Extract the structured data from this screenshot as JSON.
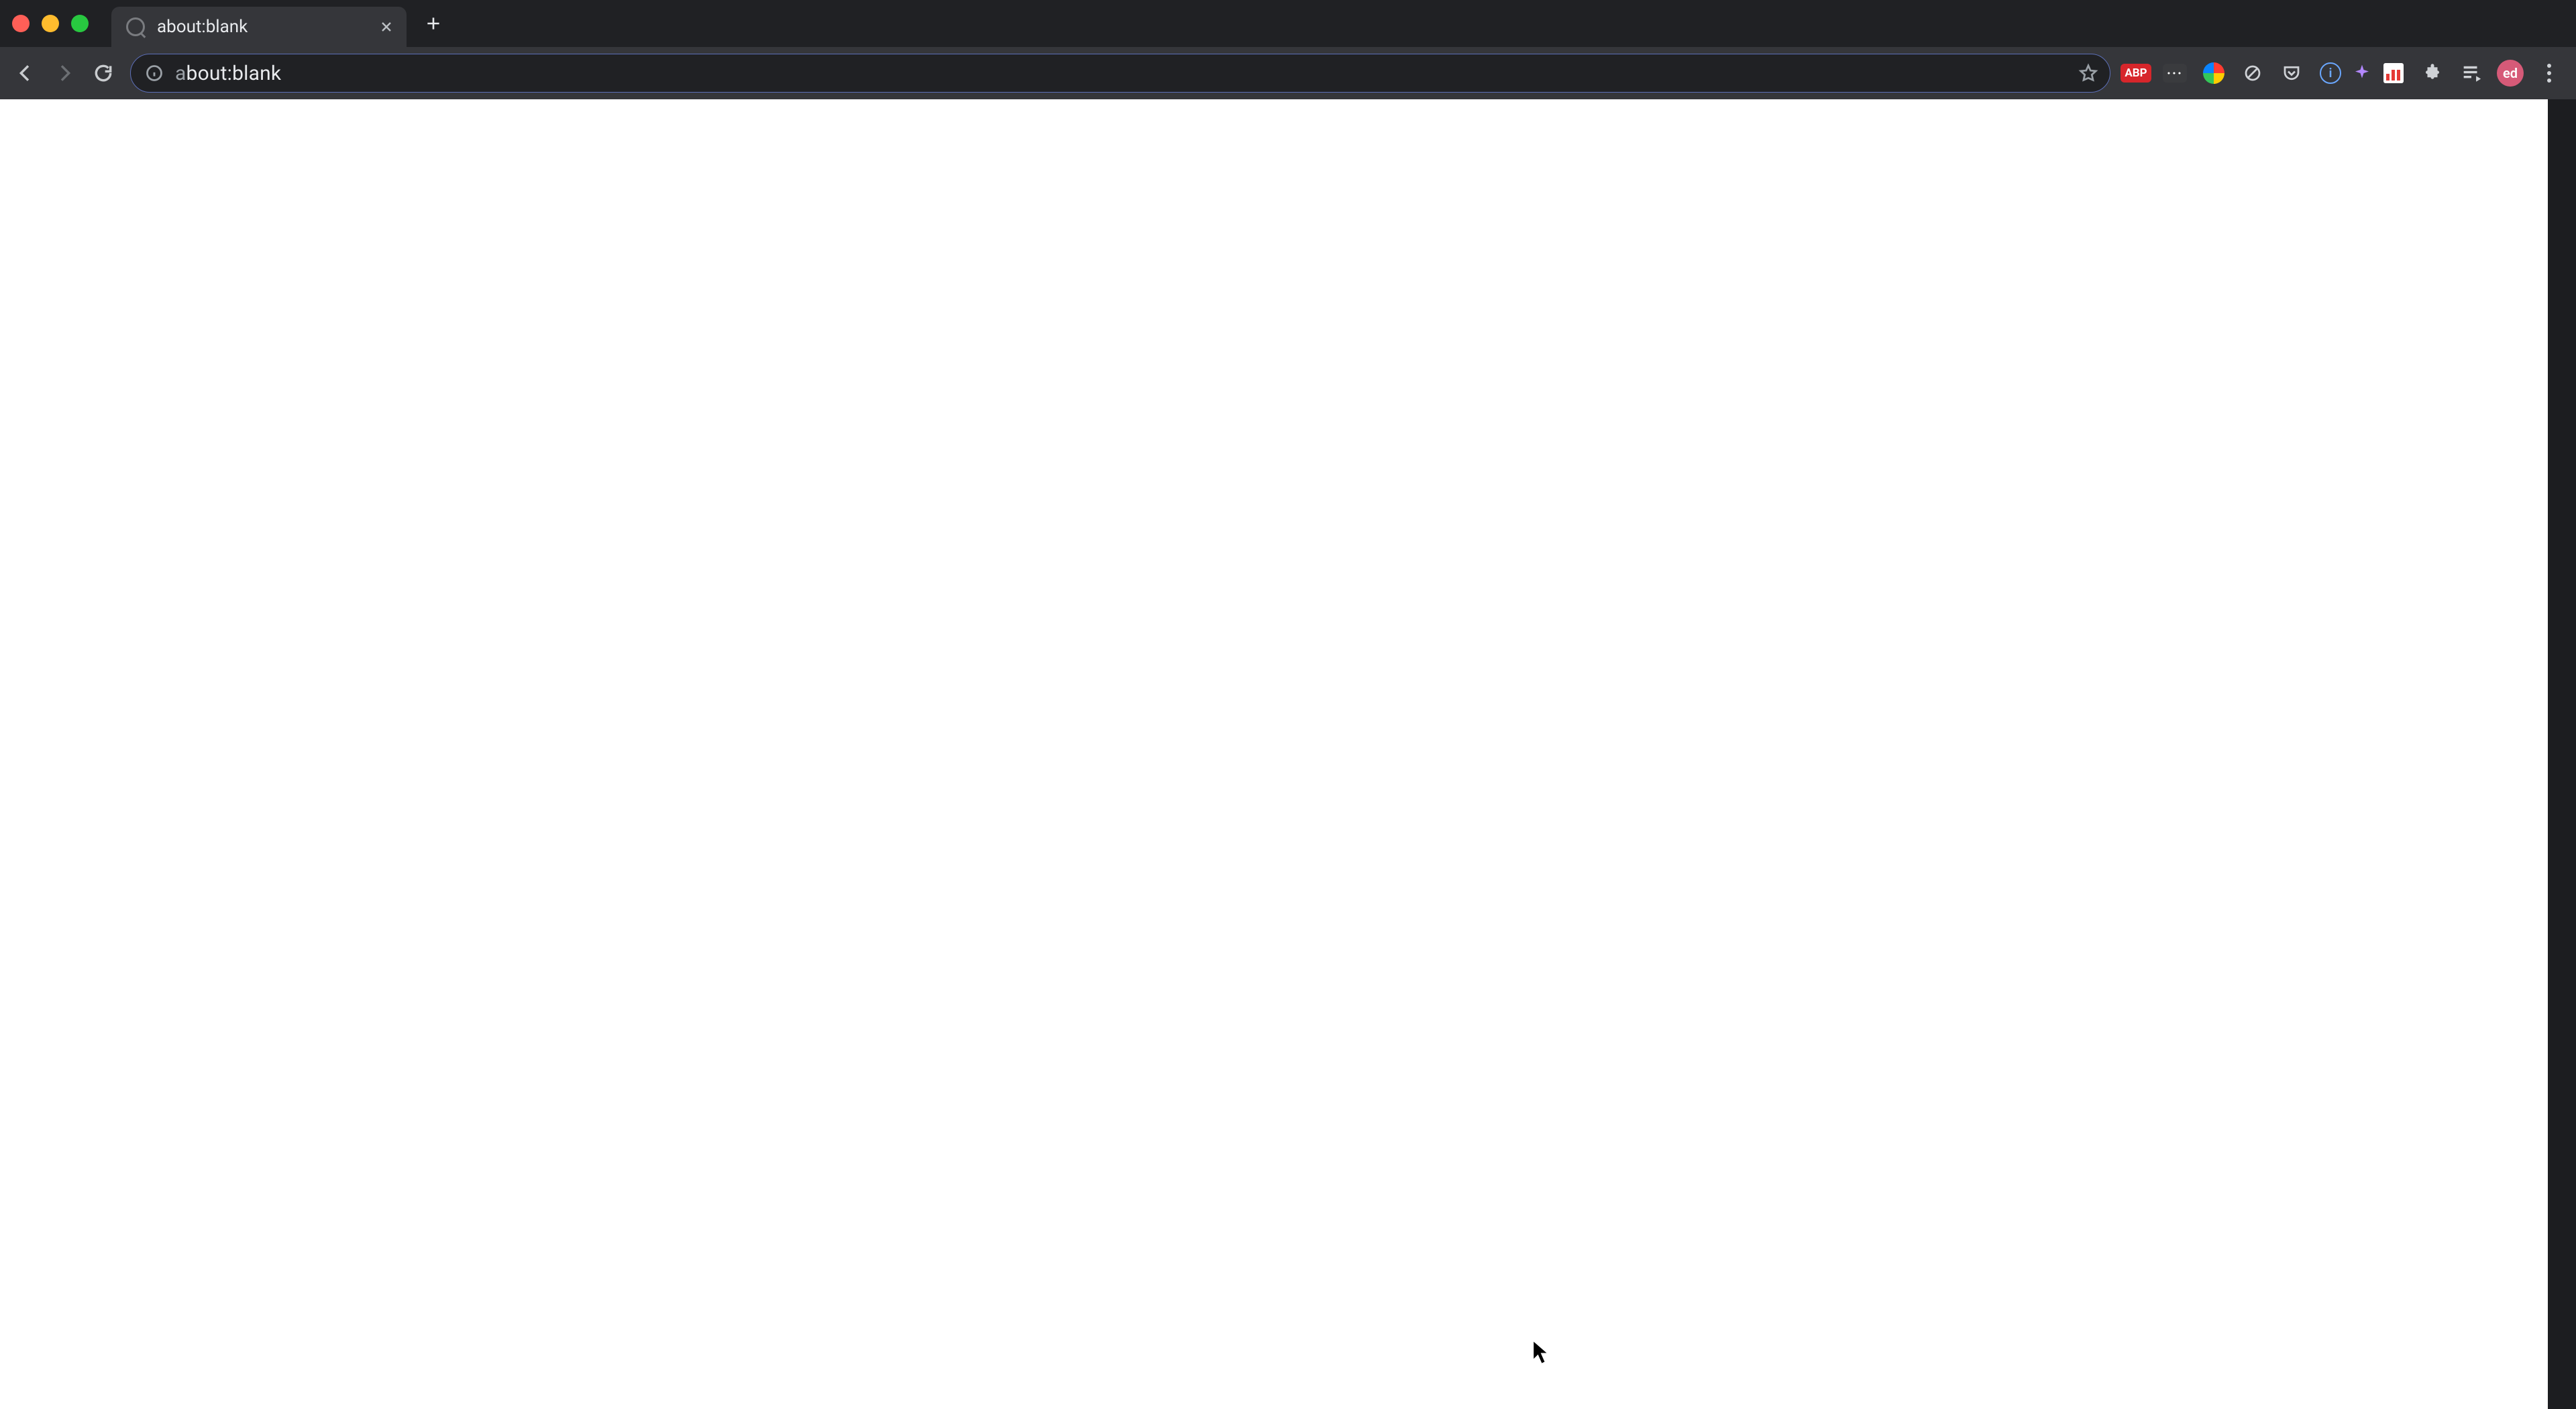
{
  "window": {
    "traffic_lights": {
      "close": "close",
      "minimize": "minimize",
      "zoom": "zoom"
    }
  },
  "tabs": [
    {
      "title": "about:blank",
      "favicon": "blank-page-icon"
    }
  ],
  "toolbar": {
    "back_label": "Back",
    "forward_label": "Forward",
    "reload_label": "Reload",
    "site_info_label": "View site information"
  },
  "omnibox": {
    "url_scheme_dim": "a",
    "url_rest": "bout:blank",
    "bookmark_label": "Bookmark this tab"
  },
  "extensions": [
    {
      "id": "abp",
      "label": "ABP",
      "kind": "badge",
      "bg": "#d7262b"
    },
    {
      "id": "dark-badge",
      "label": "···",
      "kind": "badge",
      "bg": "#3a3b3e"
    },
    {
      "id": "color-swirl",
      "label": "",
      "kind": "swirl"
    },
    {
      "id": "grey-slash",
      "label": "",
      "kind": "icon-slash"
    },
    {
      "id": "pocket",
      "label": "",
      "kind": "icon-pocket"
    },
    {
      "id": "info-circle",
      "label": "i",
      "kind": "circle-letter"
    },
    {
      "id": "purple-star",
      "label": "",
      "kind": "star"
    },
    {
      "id": "bar-chart",
      "label": "",
      "kind": "chart"
    }
  ],
  "right_cluster": {
    "extensions_button": "Extensions",
    "media_button": "Media controls",
    "profile_initials": "ed",
    "menu_button": "Chrome menu"
  },
  "page": {
    "content": ""
  }
}
